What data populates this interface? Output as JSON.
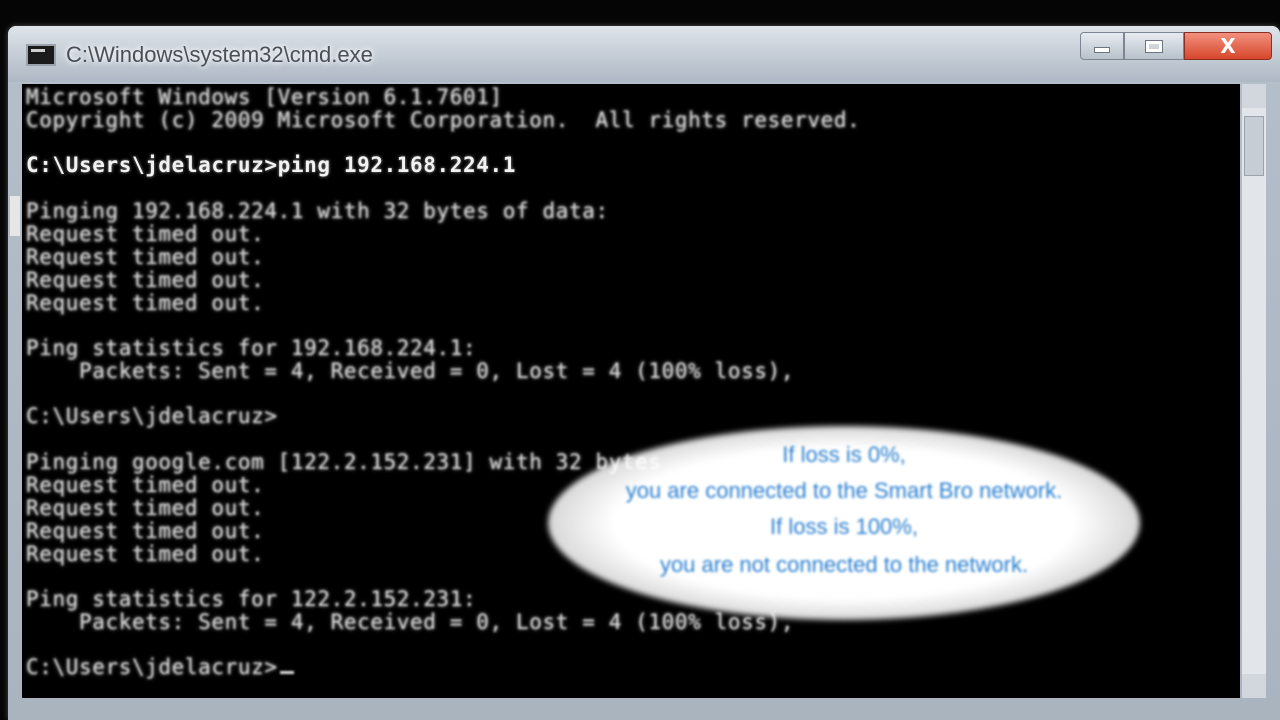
{
  "window": {
    "title": "C:\\Windows\\system32\\cmd.exe",
    "controls": {
      "minimize": "",
      "maximize": "",
      "close": "X"
    }
  },
  "console": {
    "lines": [
      "Microsoft Windows [Version 6.1.7601]",
      "Copyright (c) 2009 Microsoft Corporation.  All rights reserved.",
      "",
      "C:\\Users\\jdelacruz>ping 192.168.224.1",
      "",
      "Pinging 192.168.224.1 with 32 bytes of data:",
      "Request timed out.",
      "Request timed out.",
      "Request timed out.",
      "Request timed out.",
      "",
      "Ping statistics for 192.168.224.1:",
      "    Packets: Sent = 4, Received = 0, Lost = 4 (100% loss),",
      "",
      "C:\\Users\\jdelacruz>",
      "",
      "Pinging google.com [122.2.152.231] with 32 bytes",
      "Request timed out.",
      "Request timed out.",
      "Request timed out.",
      "Request timed out.",
      "",
      "Ping statistics for 122.2.152.231:",
      "    Packets: Sent = 4, Received = 0, Lost = 4 (100% loss),",
      "",
      "C:\\Users\\jdelacruz>"
    ]
  },
  "callout": {
    "lines": [
      "If loss is 0%,",
      "you are connected to the Smart Bro network.",
      "If loss is 100%,",
      "you are not connected to the network."
    ],
    "color": "#2a7fd0"
  }
}
